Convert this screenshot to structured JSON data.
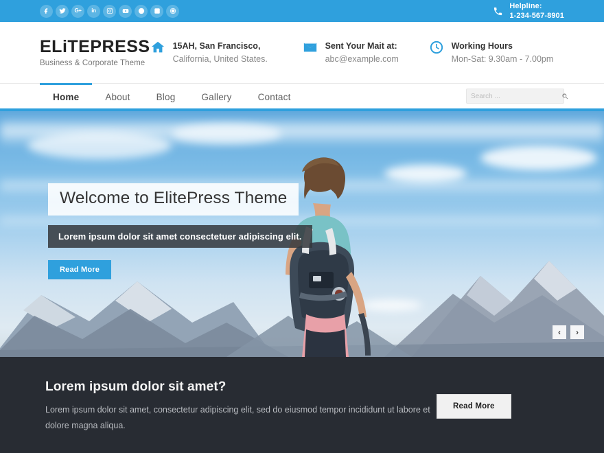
{
  "topbar": {
    "social": [
      {
        "name": "facebook",
        "glyph": "f"
      },
      {
        "name": "twitter",
        "glyph": "t"
      },
      {
        "name": "google-plus",
        "glyph": "G+"
      },
      {
        "name": "linkedin",
        "glyph": "in"
      },
      {
        "name": "instagram",
        "glyph": "ig"
      },
      {
        "name": "youtube",
        "glyph": "yt"
      },
      {
        "name": "skype",
        "glyph": "s"
      },
      {
        "name": "vimeo",
        "glyph": "v"
      },
      {
        "name": "dribbble",
        "glyph": "d"
      }
    ],
    "helpline_label": "Helpline:",
    "helpline_number": "1-234-567-8901"
  },
  "header": {
    "logo": "ELiTEPRESS",
    "tagline": "Business & Corporate Theme",
    "info": [
      {
        "icon": "home-icon",
        "line1": "15AH, San Francisco,",
        "line2": "California, United States."
      },
      {
        "icon": "envelope-icon",
        "line1": "Sent Your Mait at:",
        "line2": "abc@example.com"
      },
      {
        "icon": "clock-icon",
        "line1": "Working Hours",
        "line2": "Mon-Sat: 9.30am - 7.00pm"
      }
    ]
  },
  "nav": {
    "items": [
      {
        "label": "Home",
        "active": true
      },
      {
        "label": "About",
        "active": false
      },
      {
        "label": "Blog",
        "active": false
      },
      {
        "label": "Gallery",
        "active": false
      },
      {
        "label": "Contact",
        "active": false
      }
    ],
    "search": {
      "value": "",
      "placeholder": "Search ..."
    }
  },
  "slider": {
    "title": "Welcome to ElitePress Theme",
    "subtitle": "Lorem ipsum dolor sit amet consectetuer adipiscing elit.",
    "button": "Read More",
    "prev": "‹",
    "next": "›"
  },
  "cta": {
    "heading": "Lorem ipsum dolor sit amet?",
    "text": "Lorem ipsum dolor sit amet, consectetur adipiscing elit, sed do eiusmod tempor incididunt ut labore et dolore magna aliqua.",
    "button": "Read More"
  },
  "colors": {
    "accent": "#2fa0dd",
    "dark": "#282c33",
    "text": "#606060"
  }
}
